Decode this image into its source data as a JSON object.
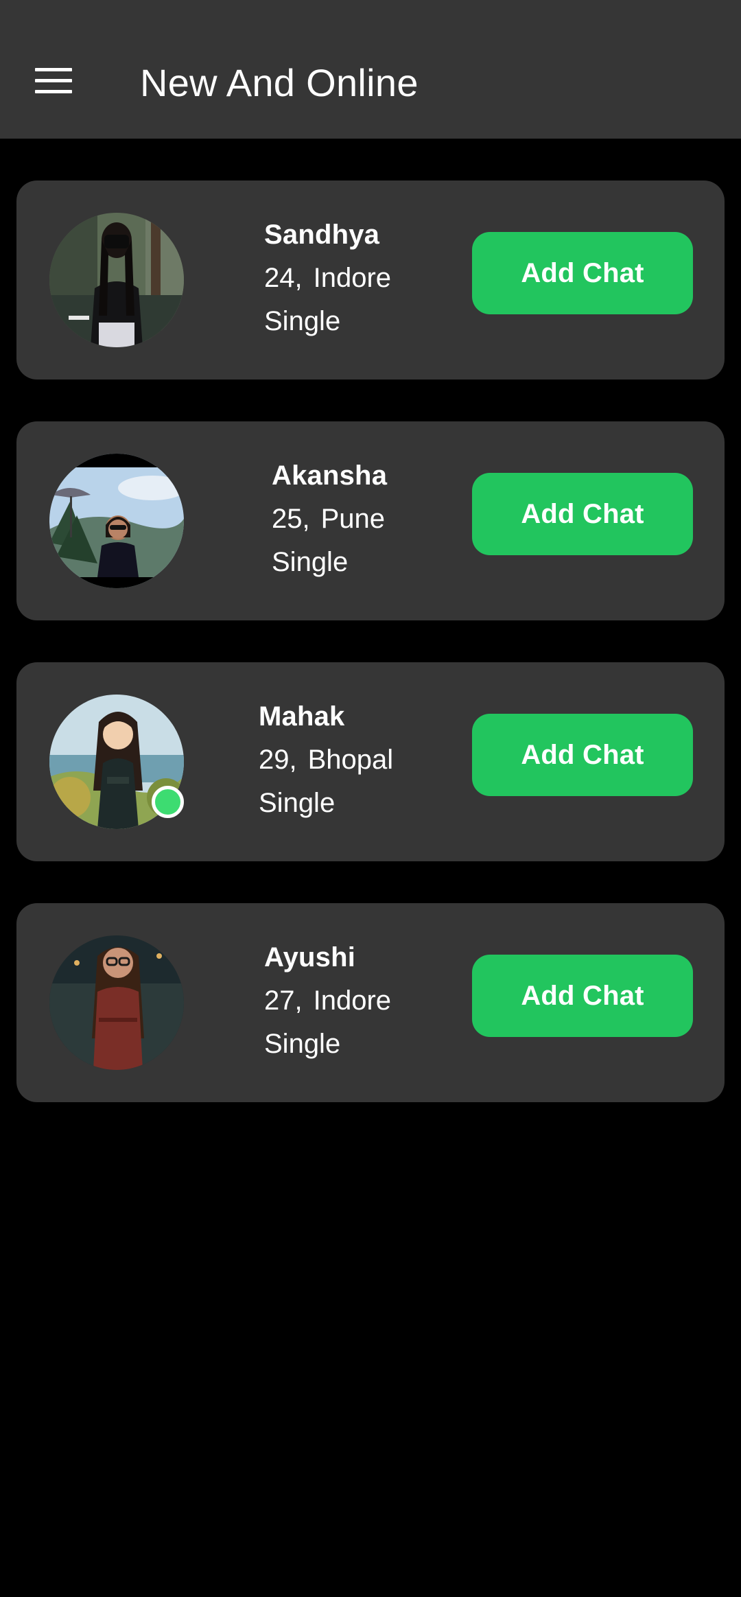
{
  "app_bar": {
    "title": "New And Online",
    "menu_icon": "hamburger-menu-icon",
    "background": "#363636"
  },
  "colors": {
    "background": "#000000",
    "card": "#363636",
    "button": "#22c55e",
    "online_indicator": "#3ddc71"
  },
  "profiles": [
    {
      "name": "Sandhya",
      "age": "24,",
      "city": "Indore",
      "status": "Single",
      "button_label": "Add Chat",
      "online": false
    },
    {
      "name": "Akansha",
      "age": "25,",
      "city": "Pune",
      "status": "Single",
      "button_label": "Add Chat",
      "online": false
    },
    {
      "name": "Mahak",
      "age": "29,",
      "city": "Bhopal",
      "status": "Single",
      "button_label": "Add Chat",
      "online": true
    },
    {
      "name": "Ayushi",
      "age": "27,",
      "city": "Indore",
      "status": "Single",
      "button_label": "Add Chat",
      "online": false
    }
  ]
}
